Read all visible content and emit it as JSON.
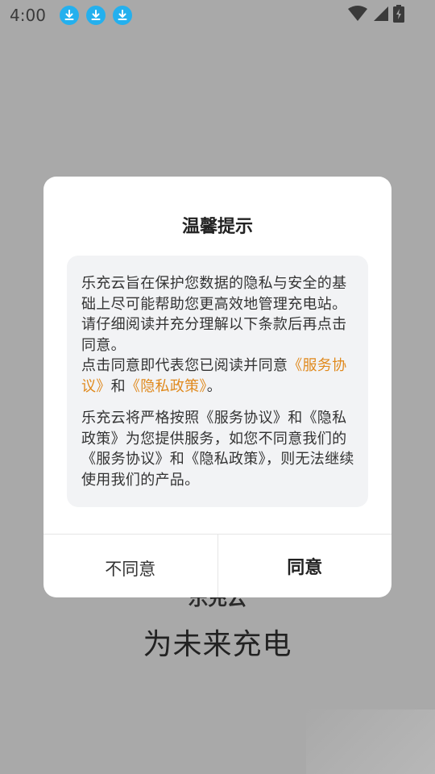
{
  "status_bar": {
    "time": "4:00",
    "notification_icons": [
      "download-icon",
      "download-icon",
      "download-icon"
    ],
    "right_icons": [
      "wifi-icon",
      "signal-icon",
      "battery-charging-icon"
    ]
  },
  "background": {
    "app_name": "乐充云",
    "slogan": "为未来充电"
  },
  "dialog": {
    "title": "温馨提示",
    "para1_text": "乐充云旨在保护您数据的隐私与安全的基础上尽可能帮助您更高效地管理充电站。请仔细阅读并充分理解以下条款后再点击同意。",
    "para1_consent_prefix": "点击同意即代表您已阅读并同意",
    "service_link": "《服务协议》",
    "and_text": "和",
    "privacy_link": "《隐私政策》",
    "period": "。",
    "para2_text": "乐充云将严格按照《服务协议》和《隐私政策》为您提供服务，如您不同意我们的《服务协议》和《隐私政策》，则无法继续使用我们的产品。",
    "disagree_label": "不同意",
    "agree_label": "同意"
  },
  "colors": {
    "overlay": "#a9a9a9",
    "link": "#e08a1e",
    "download_icon": "#24b0ee",
    "content_bg": "#f2f3f5"
  }
}
